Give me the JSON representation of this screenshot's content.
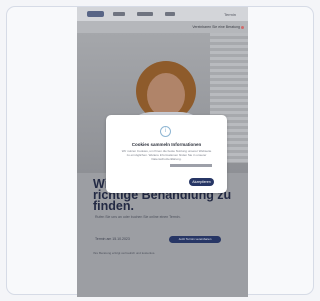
{
  "window": {
    "title": ""
  },
  "nav": {
    "logo": "",
    "items": [
      "",
      "",
      ""
    ],
    "menu_label": "Termin"
  },
  "subnav": {
    "label": "Vereinbaren Sie eine Beratung"
  },
  "hero": {
    "headline": "Wir helfen Ihnen, die richtige Behandlung zu finden.",
    "tagline": "Rufen Sie uns an oder buchen Sie online einen Termin.",
    "date_label": "Termin am 15.10.2023",
    "appointment_button": "Jetzt Termin vereinbaren",
    "footnote": "Ihre Beratung erfolgt vertraulich und kostenlos."
  },
  "cookie_modal": {
    "title": "Cookies sammeln Informationen",
    "body": "Wir nutzen Cookies, um Ihnen die beste Nutzung unserer Webseite zu ermöglichen. Weitere Informationen finden Sie in unserer Datenschutzerklärung.",
    "accept_label": "Akzeptieren"
  },
  "colors": {
    "accent": "#273665",
    "page_background": "#f4f5f8",
    "overlay": "#9c9ea3"
  }
}
